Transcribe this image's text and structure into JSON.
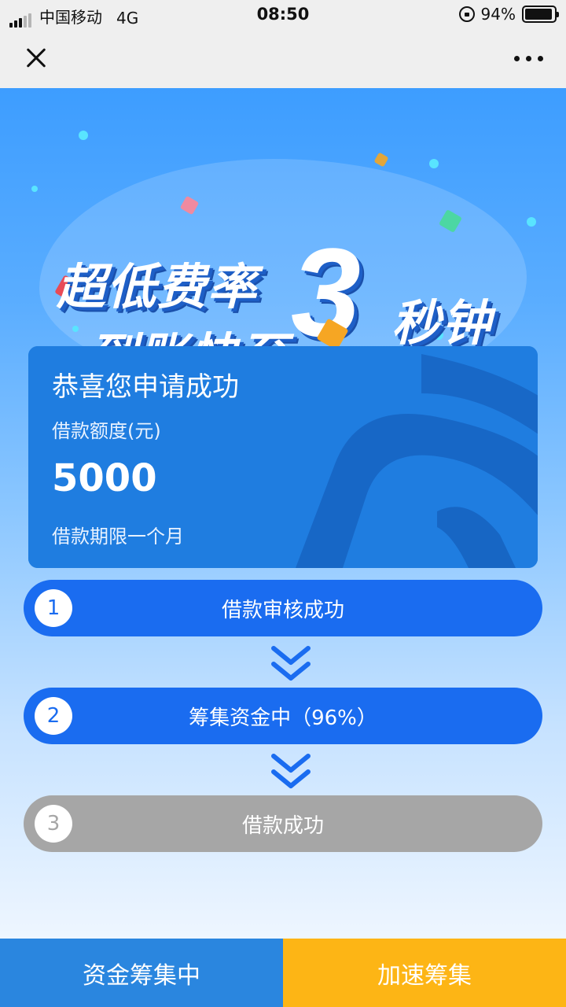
{
  "status_bar": {
    "carrier": "中国移动",
    "network": "4G",
    "time": "08:50",
    "battery": "94%",
    "battery_level": 0.94
  },
  "nav": {
    "close_icon": "close-icon",
    "more_icon": "more-icon"
  },
  "banner": {
    "line1": "超低费率",
    "line2": "到账快至",
    "big_number": "3",
    "unit": "秒钟"
  },
  "card": {
    "title": "恭喜您申请成功",
    "amount_label": "借款额度(元)",
    "amount": "5000",
    "term": "借款期限一个月"
  },
  "steps": [
    {
      "num": "1",
      "label": "借款审核成功",
      "state": "done"
    },
    {
      "num": "2",
      "label": "筹集资金中（96%）",
      "state": "active"
    },
    {
      "num": "3",
      "label": "借款成功",
      "state": "pending"
    }
  ],
  "buttons": {
    "left": "资金筹集中",
    "right": "加速筹集"
  },
  "colors": {
    "primary": "#1a6cf0",
    "pending": "#a6a6a6",
    "accent": "#fdb515",
    "bottom_left": "#2a86df"
  }
}
